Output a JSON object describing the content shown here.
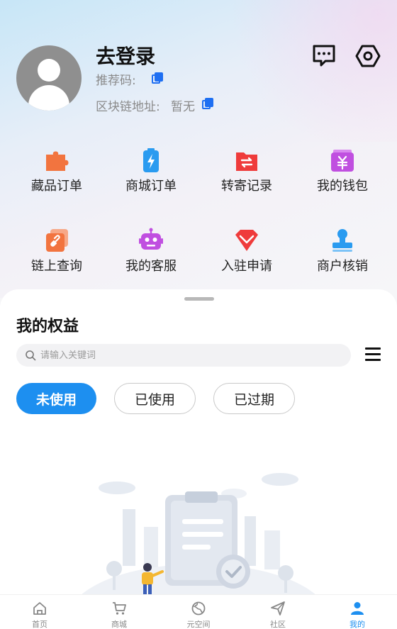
{
  "profile": {
    "login_title": "去登录",
    "referral_label": "推荐码:",
    "chain_label": "区块链地址:",
    "chain_value": "暂无"
  },
  "icons": {
    "message": "message-icon",
    "settings": "settings-icon",
    "copy": "copy-icon"
  },
  "menu": [
    {
      "label": "藏品订单",
      "icon": "puzzle-icon",
      "color": "#f2743f"
    },
    {
      "label": "商城订单",
      "icon": "battery-icon",
      "color": "#2a9bf0"
    },
    {
      "label": "转寄记录",
      "icon": "folder-transfer-icon",
      "color": "#ef3b3b"
    },
    {
      "label": "我的钱包",
      "icon": "wallet-icon",
      "color": "#c04fe0"
    },
    {
      "label": "链上查询",
      "icon": "link-icon",
      "color": "#f2743f"
    },
    {
      "label": "我的客服",
      "icon": "robot-icon",
      "color": "#c04fe0"
    },
    {
      "label": "入驻申请",
      "icon": "diamond-icon",
      "color": "#ef3b3b"
    },
    {
      "label": "商户核销",
      "icon": "stamp-icon",
      "color": "#2a9bf0"
    }
  ],
  "rights": {
    "title": "我的权益",
    "search_placeholder": "请输入关键词",
    "filters": [
      {
        "label": "未使用",
        "active": true
      },
      {
        "label": "已使用",
        "active": false
      },
      {
        "label": "已过期",
        "active": false
      }
    ]
  },
  "tabs": [
    {
      "label": "首页",
      "icon": "home-icon",
      "active": false
    },
    {
      "label": "商城",
      "icon": "cart-icon",
      "active": false
    },
    {
      "label": "元空间",
      "icon": "globe-icon",
      "active": false
    },
    {
      "label": "社区",
      "icon": "send-icon",
      "active": false
    },
    {
      "label": "我的",
      "icon": "user-icon",
      "active": true
    }
  ],
  "colors": {
    "accent": "#1d8ff0",
    "copy_icon": "#1e6ff2"
  }
}
